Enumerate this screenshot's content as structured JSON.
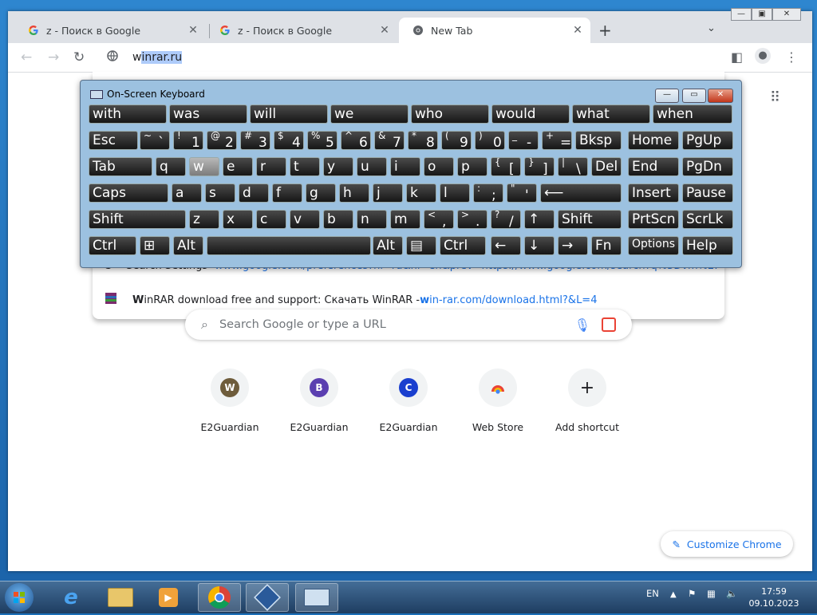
{
  "browser": {
    "tabs": [
      {
        "title": "z - Поиск в Google",
        "icon": "google-icon"
      },
      {
        "title": "z - Поиск в Google",
        "icon": "google-icon"
      },
      {
        "title": "New Tab",
        "icon": "chrome-icon"
      }
    ],
    "new_tab_glyph": "+",
    "tab_menu_glyph": "⌄",
    "omnibox": {
      "typed": "w",
      "selected": "inrar.ru"
    },
    "suggestions": [
      {
        "icon": "google-icon",
        "text": "Search Settings - ",
        "link": "www.google.com/preferences?hl=ru&hl=en&prev=https://www.google.com/search?q%3Dvm%2..."
      },
      {
        "icon": "winrar-icon",
        "text_bold": "W",
        "text": "inRAR download free and support: Скачать WinRAR - ",
        "link_bold": "w",
        "link": "in-rar.com/download.html?&L=4"
      }
    ]
  },
  "ntp": {
    "search_placeholder": "Search Google or type a URL",
    "shortcuts": [
      {
        "letter": "W",
        "label": "E2Guardian",
        "color": "#6e5c3b"
      },
      {
        "letter": "B",
        "label": "E2Guardian",
        "color": "#5b3fb0"
      },
      {
        "letter": "C",
        "label": "E2Guardian",
        "color": "#1a3fcf"
      },
      {
        "letter": "",
        "label": "Web Store",
        "color": "#ffffff"
      },
      {
        "letter": "+",
        "label": "Add shortcut",
        "color": "#f1f3f4"
      }
    ],
    "customize_label": "Customize Chrome"
  },
  "osk": {
    "title": "On-Screen Keyboard",
    "predictions": [
      "with",
      "was",
      "will",
      "we",
      "who",
      "would",
      "what",
      "when"
    ],
    "row1": [
      {
        "m": "Esc"
      },
      {
        "sh": "~",
        "lo": "`"
      },
      {
        "sh": "!",
        "lo": "1"
      },
      {
        "sh": "@",
        "lo": "2"
      },
      {
        "sh": "#",
        "lo": "3"
      },
      {
        "sh": "$",
        "lo": "4"
      },
      {
        "sh": "%",
        "lo": "5"
      },
      {
        "sh": "^",
        "lo": "6"
      },
      {
        "sh": "&",
        "lo": "7"
      },
      {
        "sh": "*",
        "lo": "8"
      },
      {
        "sh": "(",
        "lo": "9"
      },
      {
        "sh": ")",
        "lo": "0"
      },
      {
        "sh": "_",
        "lo": "-"
      },
      {
        "sh": "+",
        "lo": "="
      },
      {
        "m": "Bksp"
      },
      {
        "m": "Home"
      },
      {
        "m": "PgUp"
      }
    ],
    "row2": [
      {
        "m": "Tab"
      },
      {
        "m": "q"
      },
      {
        "m": "w"
      },
      {
        "m": "e"
      },
      {
        "m": "r"
      },
      {
        "m": "t"
      },
      {
        "m": "y"
      },
      {
        "m": "u"
      },
      {
        "m": "i"
      },
      {
        "m": "o"
      },
      {
        "m": "p"
      },
      {
        "sh": "{",
        "lo": "["
      },
      {
        "sh": "}",
        "lo": "]"
      },
      {
        "sh": "|",
        "lo": "\\"
      },
      {
        "m": "Del"
      },
      {
        "m": "End"
      },
      {
        "m": "PgDn"
      }
    ],
    "row3": [
      {
        "m": "Caps"
      },
      {
        "m": "a"
      },
      {
        "m": "s"
      },
      {
        "m": "d"
      },
      {
        "m": "f"
      },
      {
        "m": "g"
      },
      {
        "m": "h"
      },
      {
        "m": "j"
      },
      {
        "m": "k"
      },
      {
        "m": "l"
      },
      {
        "sh": ":",
        "lo": ";"
      },
      {
        "sh": "\"",
        "lo": "'"
      },
      {
        "m": "⟵"
      },
      {
        "m": "Insert"
      },
      {
        "m": "Pause"
      }
    ],
    "row4": [
      {
        "m": "Shift"
      },
      {
        "m": "z"
      },
      {
        "m": "x"
      },
      {
        "m": "c"
      },
      {
        "m": "v"
      },
      {
        "m": "b"
      },
      {
        "m": "n"
      },
      {
        "m": "m"
      },
      {
        "sh": "<",
        "lo": ","
      },
      {
        "sh": ">",
        "lo": "."
      },
      {
        "sh": "?",
        "lo": "/"
      },
      {
        "m": "↑"
      },
      {
        "m": "Shift"
      },
      {
        "m": "PrtScn"
      },
      {
        "m": "ScrLk"
      }
    ],
    "row5": [
      {
        "m": "Ctrl"
      },
      {
        "m": "⊞"
      },
      {
        "m": "Alt"
      },
      {
        "m": ""
      },
      {
        "m": "Alt"
      },
      {
        "m": "▤"
      },
      {
        "m": "Ctrl"
      },
      {
        "m": "←"
      },
      {
        "m": "↓"
      },
      {
        "m": "→"
      },
      {
        "m": "Fn"
      },
      {
        "m": "Options"
      },
      {
        "m": "Help"
      }
    ],
    "pressed_key": "w"
  },
  "taskbar": {
    "language": "EN",
    "time": "17:59",
    "date": "09.10.2023"
  }
}
